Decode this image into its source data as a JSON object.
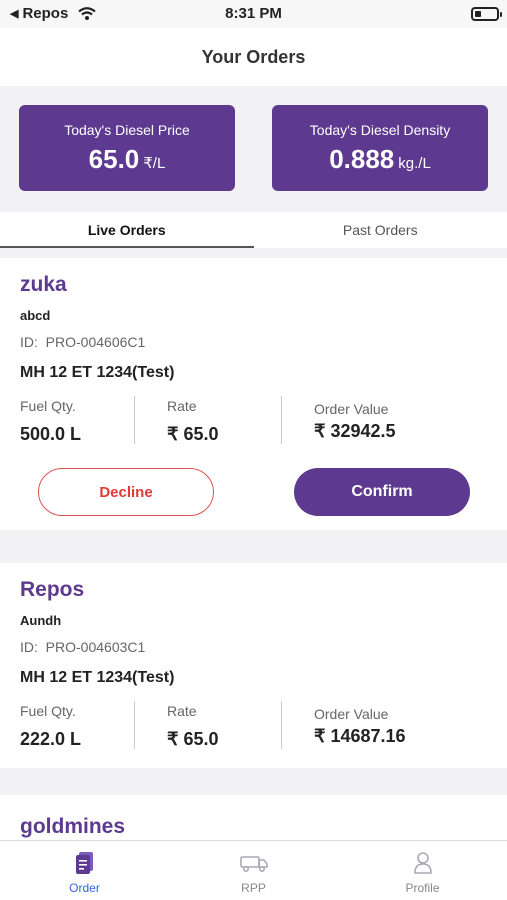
{
  "status_bar": {
    "back_app": "Repos",
    "time": "8:31 PM"
  },
  "header": {
    "title": "Your Orders"
  },
  "stats": {
    "price_label": "Today's Diesel Price",
    "price_value": "65.0",
    "price_unit": "₹/L",
    "density_label": "Today's Diesel Density",
    "density_value": "0.888",
    "density_unit": "kg./L"
  },
  "tabs": {
    "live": "Live Orders",
    "past": "Past Orders"
  },
  "labels": {
    "id_prefix": "ID:",
    "fuel_qty": "Fuel Qty.",
    "rate": "Rate",
    "order_value": "Order Value",
    "decline": "Decline",
    "confirm": "Confirm"
  },
  "orders": [
    {
      "customer": "zuka",
      "location": "abcd",
      "id": "PRO-004606C1",
      "vehicle": "MH 12 ET 1234(Test)",
      "fuel_qty": "500.0 L",
      "rate": "₹ 65.0",
      "order_value": "₹ 32942.5"
    },
    {
      "customer": "Repos",
      "location": "Aundh",
      "id": "PRO-004603C1",
      "vehicle": "MH 12 ET 1234(Test)",
      "fuel_qty": "222.0 L",
      "rate": "₹ 65.0",
      "order_value": "₹ 14687.16"
    },
    {
      "customer": "goldmines"
    }
  ],
  "bottom_nav": {
    "order": "Order",
    "rpp": "RPP",
    "profile": "Profile"
  },
  "colors": {
    "accent": "#5d3a8f",
    "decline": "#e03a3a",
    "nav_active": "#2e6ad6"
  }
}
